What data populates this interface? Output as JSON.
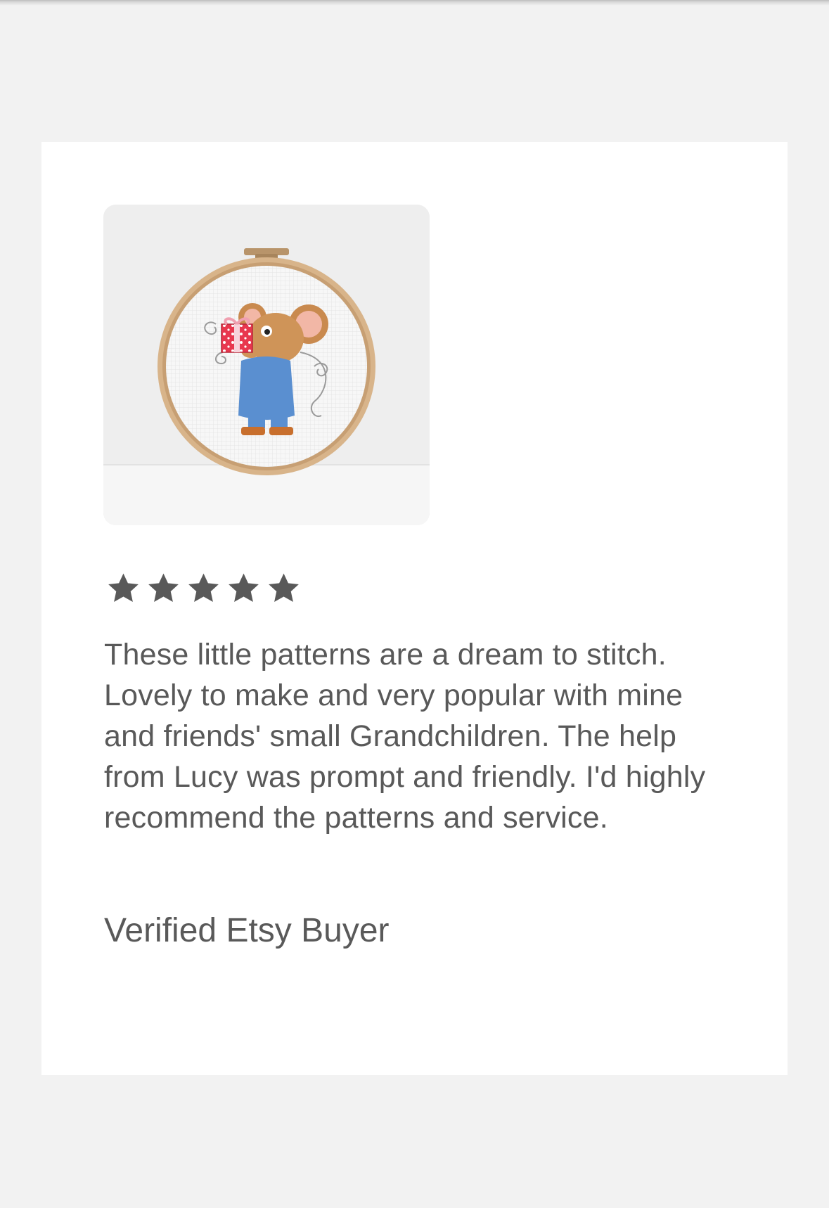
{
  "review": {
    "image_alt": "Cross stitch mouse holding a red polka dot gift in an embroidery hoop",
    "rating": 5,
    "rating_max": 5,
    "text": "These little patterns are a dream to stitch. Lovely to make and very popular with mine and friends' small Grandchildren. The help from Lucy was prompt and friendly. I'd highly recommend the patterns and service.",
    "author": "Verified Etsy Buyer",
    "star_icon": "star-icon"
  },
  "colors": {
    "page_background": "#f2f2f2",
    "card_background": "#ffffff",
    "text": "#595959",
    "star": "#595959"
  }
}
